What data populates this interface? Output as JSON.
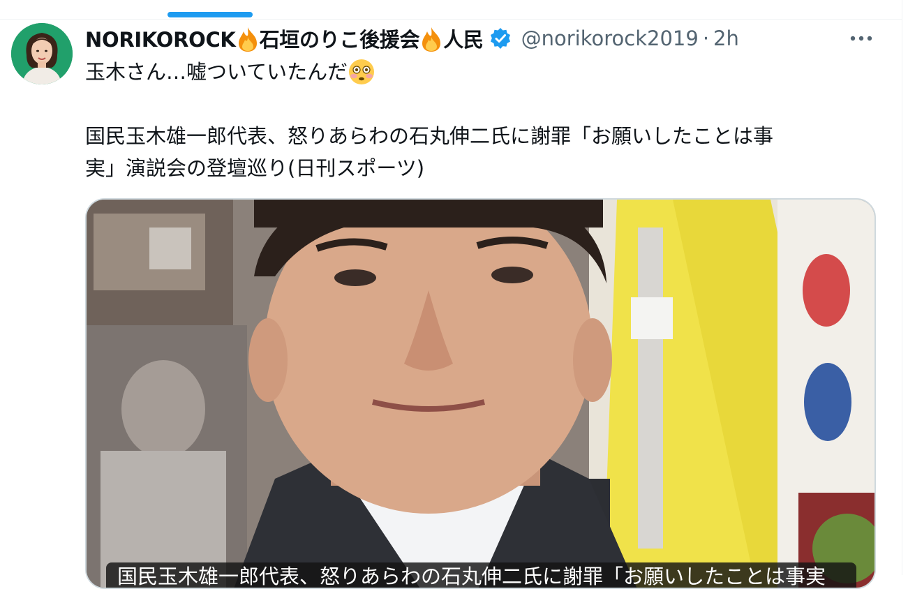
{
  "tweet": {
    "author": {
      "name_part1": "NORIKOROCK",
      "name_part2": "石垣のりこ後援会",
      "name_part3": "人民",
      "handle": "@norikorock2019",
      "separator": "·",
      "time": "2h",
      "verified": true
    },
    "text_line1": "玉木さん…嘘ついていたんだ",
    "text_line2": "国民玉木雄一郎代表、怒りあらわの石丸伸二氏に謝罪「お願いしたことは事",
    "text_line3": "実」演説会の登壇巡り(日刊スポーツ)",
    "media_caption": "国民玉木雄一郎代表、怒りあらわの石丸伸二氏に謝罪「お願いしたことは事実",
    "icons": {
      "fire": "fire-icon",
      "verified": "verified-badge-icon",
      "flushed": "flushed-face-icon",
      "more": "more-icon"
    }
  },
  "colors": {
    "accent": "#1d9bf0",
    "text": "#0f1419",
    "muted": "#536471"
  }
}
